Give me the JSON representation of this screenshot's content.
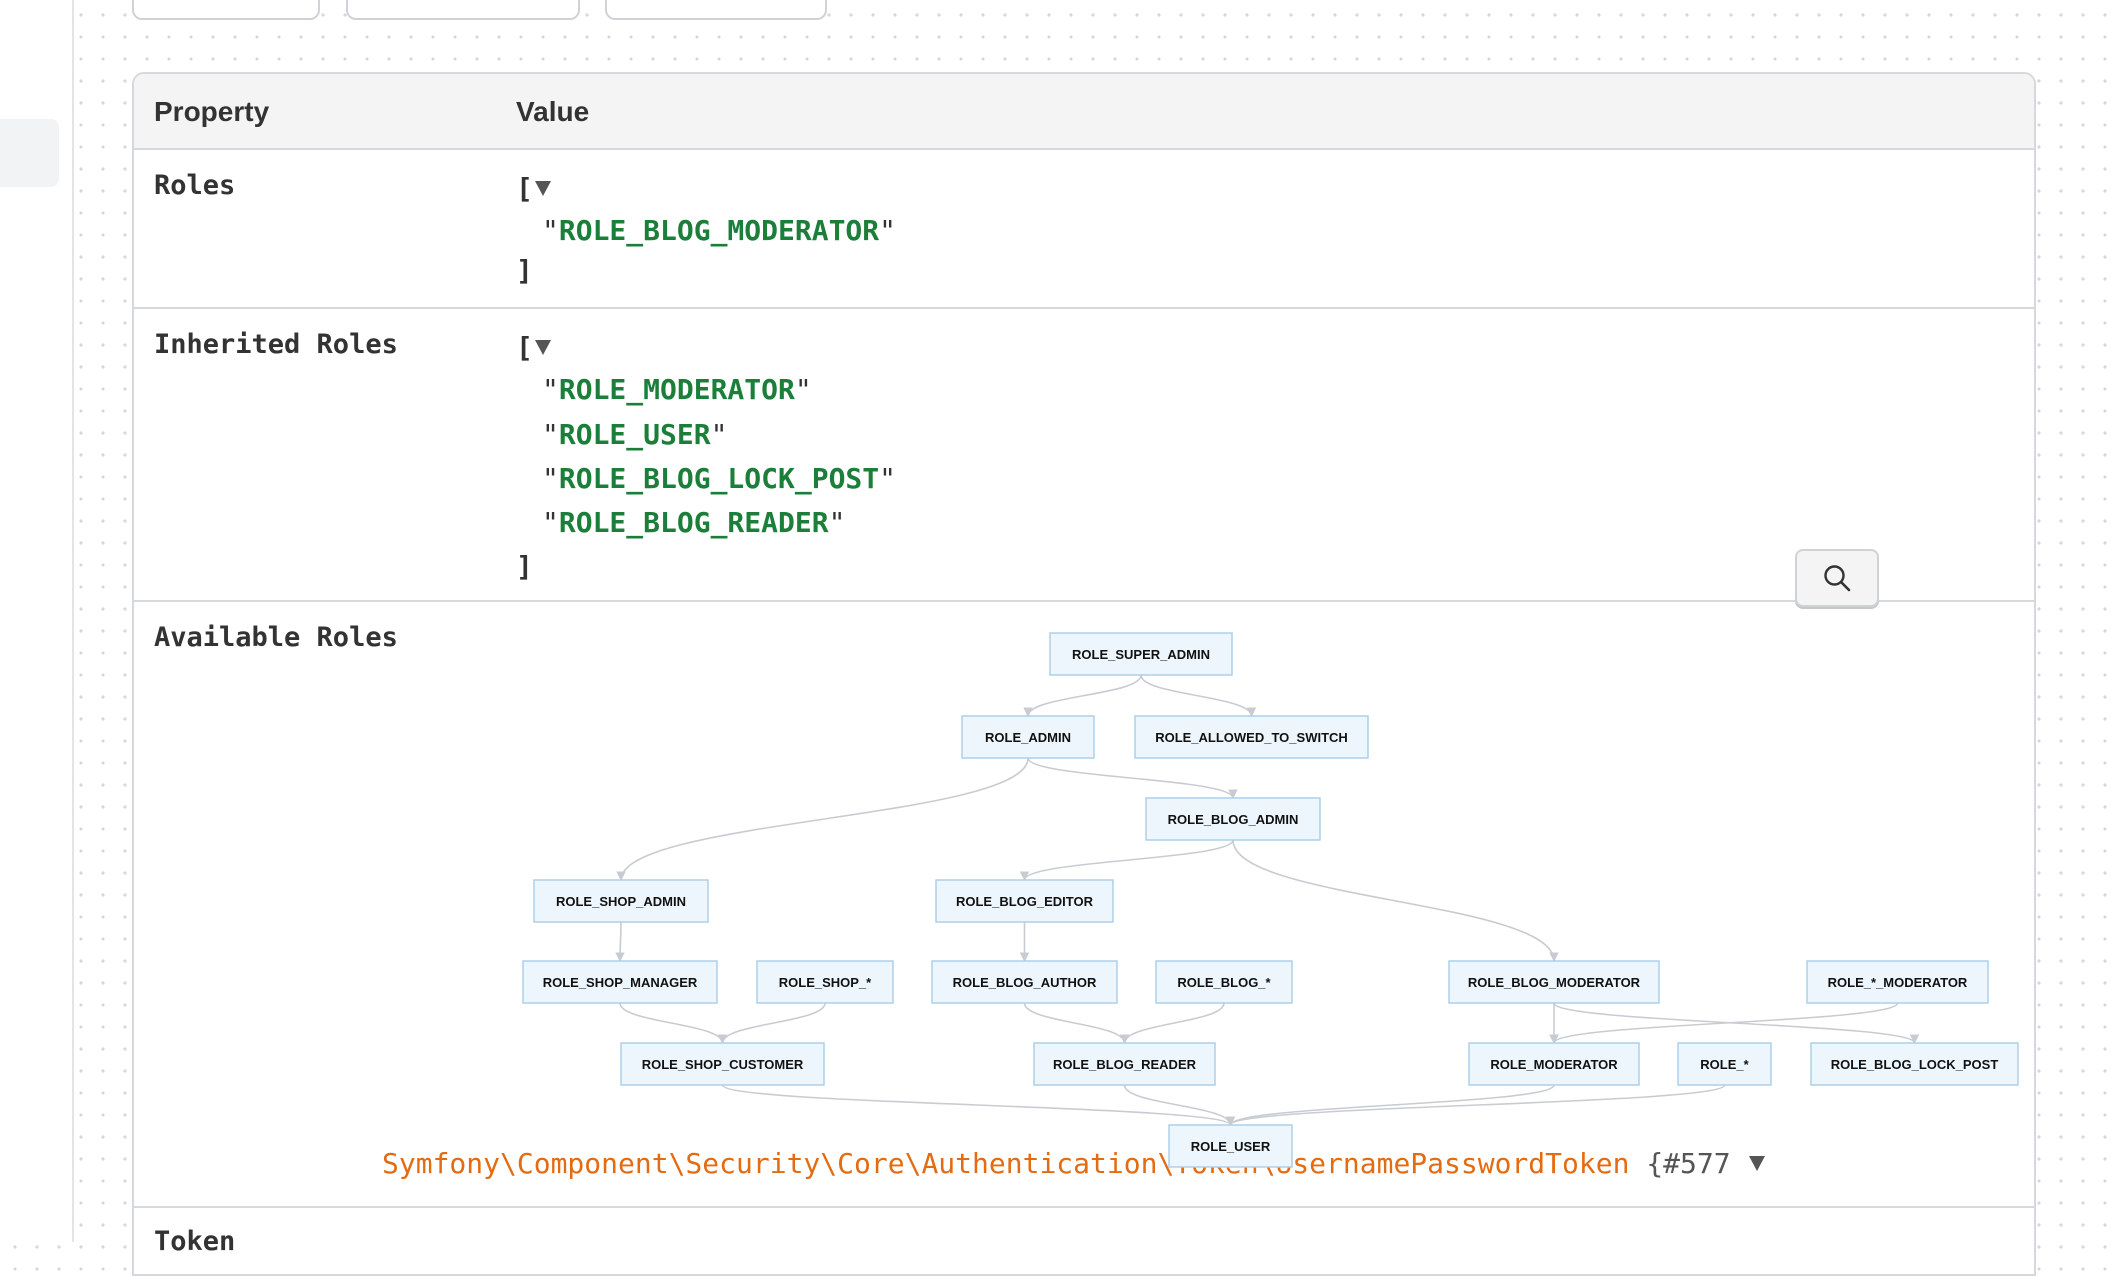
{
  "table": {
    "header": {
      "property": "Property",
      "value": "Value"
    },
    "rows": {
      "roles": {
        "label": "Roles",
        "open": "[",
        "close": "]",
        "items": [
          "ROLE_BLOG_MODERATOR"
        ]
      },
      "inherited": {
        "label": "Inherited Roles",
        "open": "[",
        "close": "]",
        "items": [
          "ROLE_MODERATOR",
          "ROLE_USER",
          "ROLE_BLOG_LOCK_POST",
          "ROLE_BLOG_READER"
        ]
      },
      "available": {
        "label": "Available Roles"
      },
      "token": {
        "label": "Token",
        "class_path": "Symfony\\Component\\Security\\Core\\Authentication\\Token\\UsernamePasswordToken",
        "object_id": "{#577"
      }
    }
  },
  "zoom_button": {
    "icon": "search-icon"
  },
  "role_graph": {
    "nodes": [
      {
        "id": "super_admin",
        "label": "ROLE_SUPER_ADMIN"
      },
      {
        "id": "admin",
        "label": "ROLE_ADMIN"
      },
      {
        "id": "allowed_switch",
        "label": "ROLE_ALLOWED_TO_SWITCH"
      },
      {
        "id": "blog_admin",
        "label": "ROLE_BLOG_ADMIN"
      },
      {
        "id": "shop_admin",
        "label": "ROLE_SHOP_ADMIN"
      },
      {
        "id": "blog_editor",
        "label": "ROLE_BLOG_EDITOR"
      },
      {
        "id": "shop_manager",
        "label": "ROLE_SHOP_MANAGER"
      },
      {
        "id": "shop_star",
        "label": "ROLE_SHOP_*"
      },
      {
        "id": "blog_author",
        "label": "ROLE_BLOG_AUTHOR"
      },
      {
        "id": "blog_star",
        "label": "ROLE_BLOG_*"
      },
      {
        "id": "blog_moderator",
        "label": "ROLE_BLOG_MODERATOR"
      },
      {
        "id": "star_moderator",
        "label": "ROLE_*_MODERATOR"
      },
      {
        "id": "shop_customer",
        "label": "ROLE_SHOP_CUSTOMER"
      },
      {
        "id": "blog_reader",
        "label": "ROLE_BLOG_READER"
      },
      {
        "id": "moderator",
        "label": "ROLE_MODERATOR"
      },
      {
        "id": "role_star",
        "label": "ROLE_*"
      },
      {
        "id": "blog_lock_post",
        "label": "ROLE_BLOG_LOCK_POST"
      },
      {
        "id": "user",
        "label": "ROLE_USER"
      }
    ],
    "edges": [
      [
        "super_admin",
        "admin"
      ],
      [
        "super_admin",
        "allowed_switch"
      ],
      [
        "admin",
        "blog_admin"
      ],
      [
        "admin",
        "shop_admin"
      ],
      [
        "blog_admin",
        "blog_editor"
      ],
      [
        "blog_admin",
        "blog_moderator"
      ],
      [
        "shop_admin",
        "shop_manager"
      ],
      [
        "blog_editor",
        "blog_author"
      ],
      [
        "shop_manager",
        "shop_customer"
      ],
      [
        "shop_star",
        "shop_customer"
      ],
      [
        "blog_author",
        "blog_reader"
      ],
      [
        "blog_star",
        "blog_reader"
      ],
      [
        "blog_moderator",
        "moderator"
      ],
      [
        "blog_moderator",
        "blog_lock_post"
      ],
      [
        "star_moderator",
        "moderator"
      ],
      [
        "shop_customer",
        "user"
      ],
      [
        "blog_reader",
        "user"
      ],
      [
        "moderator",
        "user"
      ],
      [
        "role_star",
        "user"
      ]
    ]
  },
  "colors": {
    "role_string": "#1b7f3a",
    "node_fill": "#eef6fd",
    "node_stroke": "#a9cde8",
    "edge": "#c8ccd2",
    "token_class": "#e36b12"
  }
}
